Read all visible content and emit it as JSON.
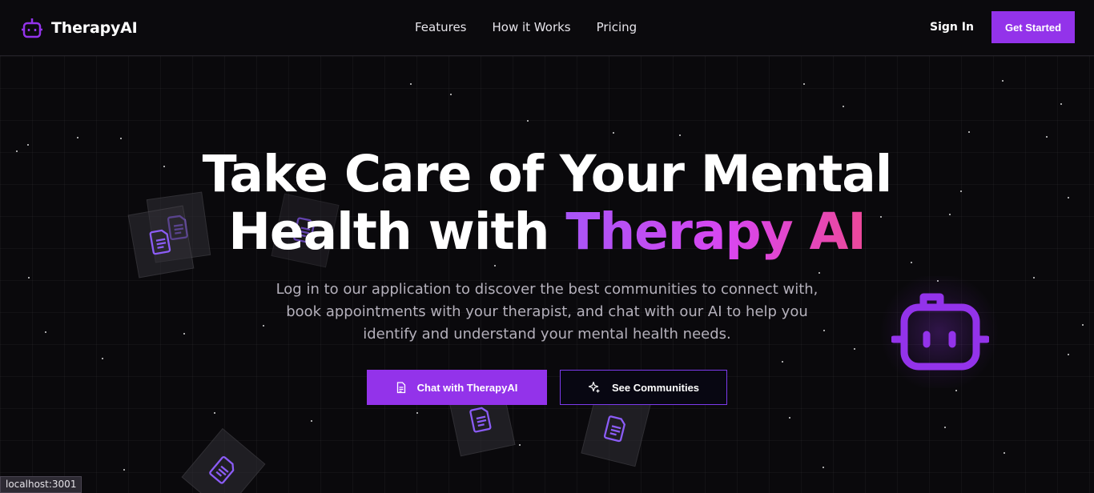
{
  "brand": {
    "name": "TherapyAI",
    "icon": "robot-icon"
  },
  "nav": {
    "links": [
      "Features",
      "How it Works",
      "Pricing"
    ],
    "sign_in": "Sign In",
    "get_started": "Get Started"
  },
  "hero": {
    "title_line1": "Take Care of Your Mental",
    "title_line2_prefix": "Health with ",
    "title_accent": "Therapy AI",
    "subtitle": "Log in to our application to discover the best communities to connect with, book appointments with your therapist, and chat with our AI to help you identify and understand your mental health needs.",
    "primary_cta": {
      "label": "Chat with TherapyAI",
      "icon": "document-icon"
    },
    "secondary_cta": {
      "label": "See Communities",
      "icon": "sparkles-icon"
    }
  },
  "status_bar": {
    "url": "localhost:3001"
  },
  "colors": {
    "accent": "#9333ea",
    "gradient_start": "#a855f7",
    "gradient_end": "#ec4899",
    "background": "#0a090c"
  }
}
